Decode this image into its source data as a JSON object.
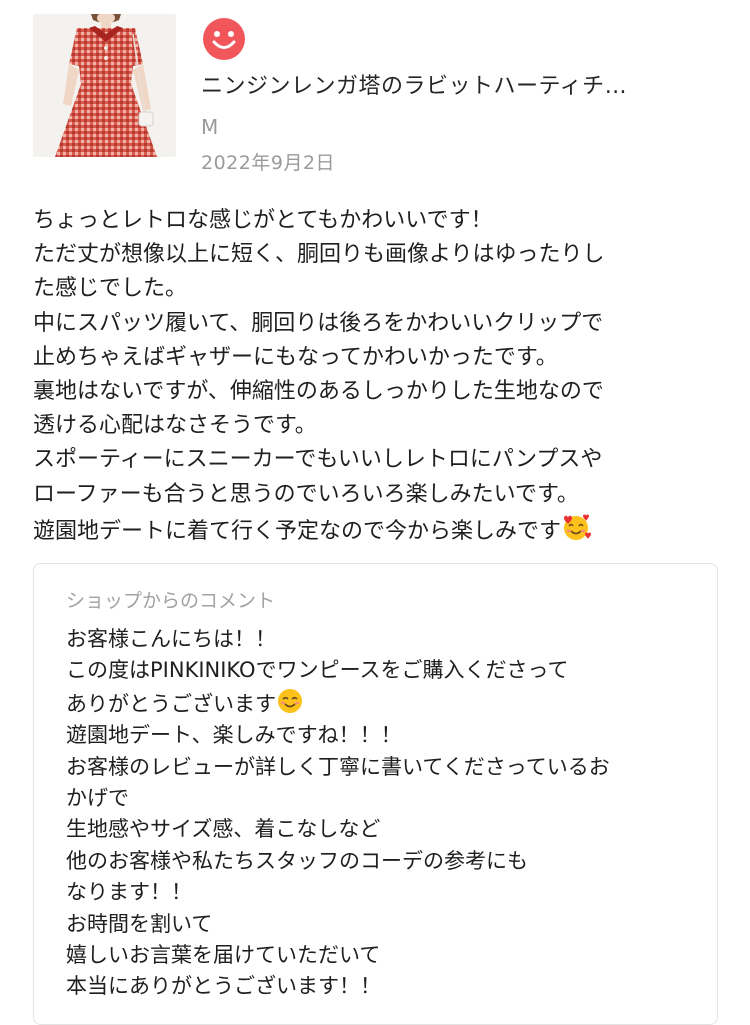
{
  "product": {
    "name": "ニンジンレンガ塔のラビットハーティチ…",
    "size": "M",
    "date": "2022年9月2日",
    "thumbnail_icon": "red-gingham-dress-thumbnail",
    "reviewer_icon": "smiley-face-icon"
  },
  "review": {
    "lines": [
      "ちょっとレトロな感じがとてもかわいいです！",
      "ただ丈が想像以上に短く、胴回りも画像よりはゆったりし",
      "た感じでした。",
      "中にスパッツ履いて、胴回りは後ろをかわいいクリップで",
      "止めちゃえばギャザーにもなってかわいかったです。",
      "裏地はないですが、伸縮性のあるしっかりした生地なので",
      "透ける心配はなさそうです。",
      "スポーティーにスニーカーでもいいしレトロにパンプスや",
      "ローファーも合うと思うのでいろいろ楽しみたいです。",
      "遊園地デートに着て行く予定なので今から楽しみです"
    ]
  },
  "shop_comment": {
    "title": "ショップからのコメント",
    "lines": [
      "お客様こんにちは！！",
      "この度はPINKINIKOでワンピースをご購入くださって",
      "ありがとうございます",
      "遊園地デート、楽しみですね！！！",
      "お客様のレビューが詳しく丁寧に書いてくださっているお",
      "かげで",
      "生地感やサイズ感、着こなしなど",
      "他のお客様や私たちスタッフのコーデの参考にも",
      "なります！！",
      "お時間を割いて",
      "嬉しいお言葉を届けていただいて",
      "本当にありがとうございます！！"
    ]
  },
  "colors": {
    "reviewer_icon": "#f0565a",
    "dress": "#c9423a",
    "card_border": "#e3e3e3",
    "muted_text": "#9a9a9a"
  }
}
